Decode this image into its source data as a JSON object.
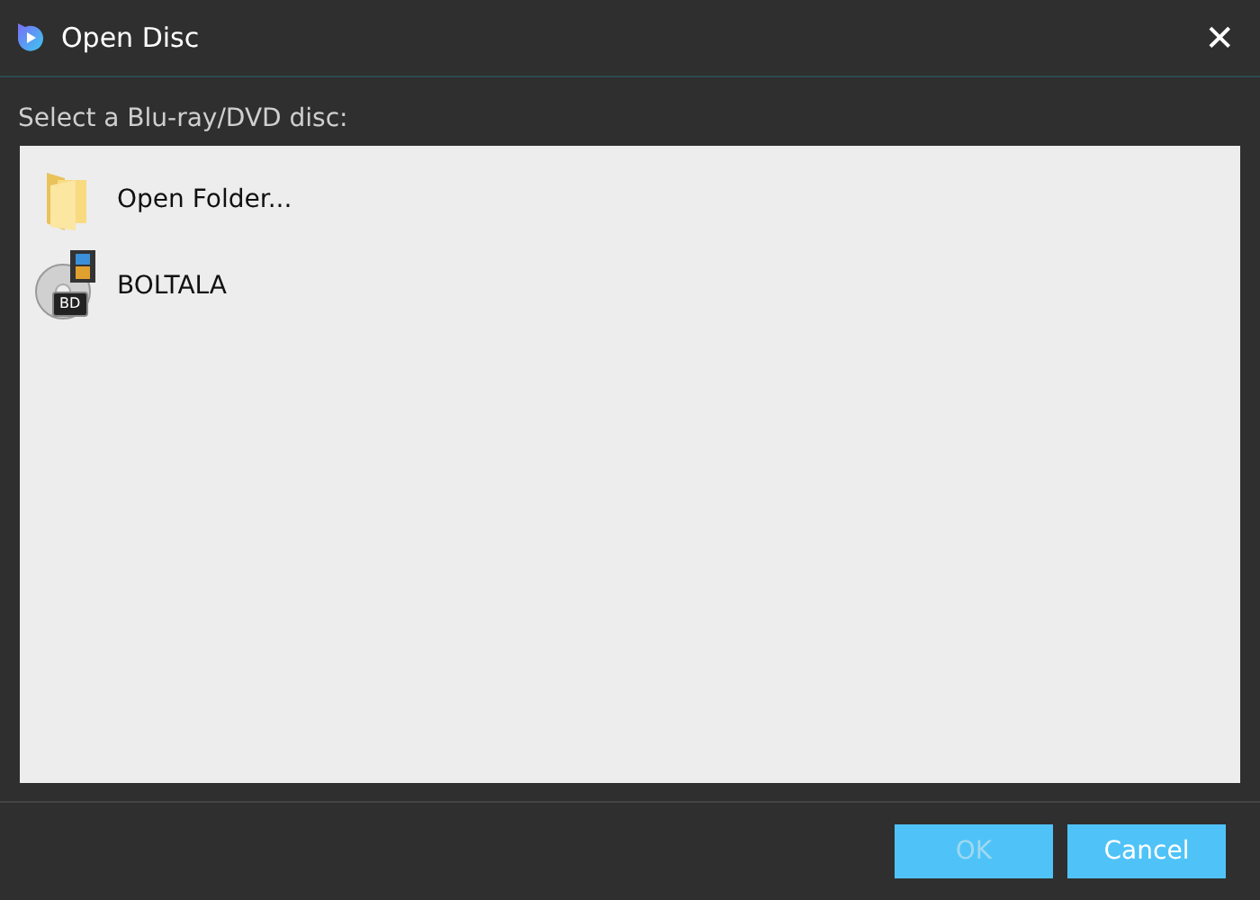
{
  "window": {
    "title": "Open Disc",
    "close": "✕"
  },
  "prompt": "Select a Blu-ray/DVD disc:",
  "items": [
    {
      "kind": "folder",
      "label": "Open Folder..."
    },
    {
      "kind": "disc",
      "label": "BOLTALA",
      "badge": "BD"
    }
  ],
  "buttons": [
    {
      "label": "OK",
      "disabled": true
    },
    {
      "label": "Cancel",
      "disabled": false
    }
  ]
}
